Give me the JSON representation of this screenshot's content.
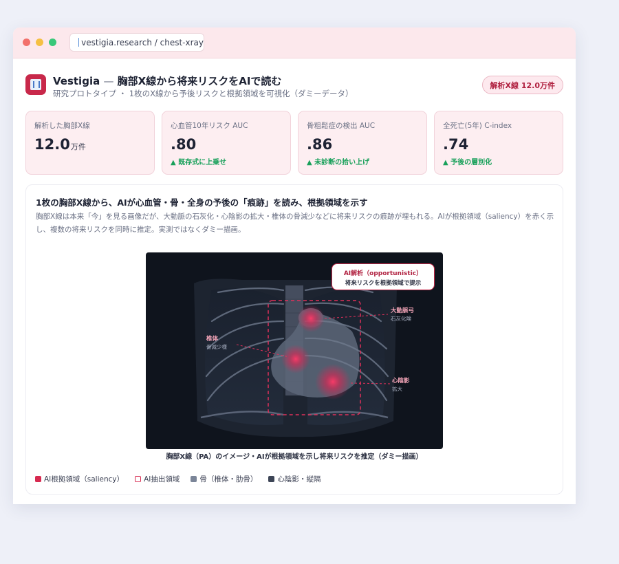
{
  "browser": {
    "url": "vestigia.research / chest-xray"
  },
  "header": {
    "title": "Vestigia",
    "title_sep": "—",
    "title_rest": "胸部X線から将来リスクをAIで読む",
    "subtitle": "研究プロトタイプ ・ 1枚のX線から予後リスクと根拠領域を可視化（ダミーデータ）",
    "badge": "解析X線 12.0万件"
  },
  "stats": [
    {
      "label": "解析した胸部X線",
      "value": "12.0",
      "unit": "万件",
      "delta": ""
    },
    {
      "label": "心血管10年リスク AUC",
      "value": ".80",
      "unit": "",
      "delta": "▲ 既存式に上乗せ"
    },
    {
      "label": "骨粗鬆症の検出 AUC",
      "value": ".86",
      "unit": "",
      "delta": "▲ 未診断の拾い上げ"
    },
    {
      "label": "全死亡(5年) C-index",
      "value": ".74",
      "unit": "",
      "delta": "▲ 予後の層別化"
    }
  ],
  "panel": {
    "title": "1枚の胸部X線から、AIが心血管・骨・全身の予後の「痕跡」を読み、根拠領域を示す",
    "desc": "胸部X線は本来「今」を見る画像だが、大動脈の石灰化・心陰影の拡大・椎体の骨減少などに将来リスクの痕跡が埋もれる。AIが根拠領域（saliency）を赤く示し、複数の将来リスクを同時に推定。実測ではなくダミー描画。",
    "caption": "胸部X線（PA）のイメージ・AIが根拠領域を示し将来リスクを推定（ダミー描画）"
  },
  "xray": {
    "callout_title": "AI解析（opportunistic）",
    "callout_sub": "将来リスクを根拠領域で提示",
    "annotations": [
      {
        "main": "大動脈弓",
        "sub": "石灰化険"
      },
      {
        "main": "椎体",
        "sub": "骨減少様"
      },
      {
        "main": "心陰影",
        "sub": "拡大"
      }
    ]
  },
  "legend": [
    "AI根拠領域（saliency）",
    "AI抽出領域",
    "骨（椎体・肋骨）",
    "心陰影・縦隔"
  ],
  "colors": {
    "accent": "#c8284a",
    "positive": "#18a05a",
    "card_bg": "#fdeef1",
    "xray_bg": "#0f141d"
  }
}
